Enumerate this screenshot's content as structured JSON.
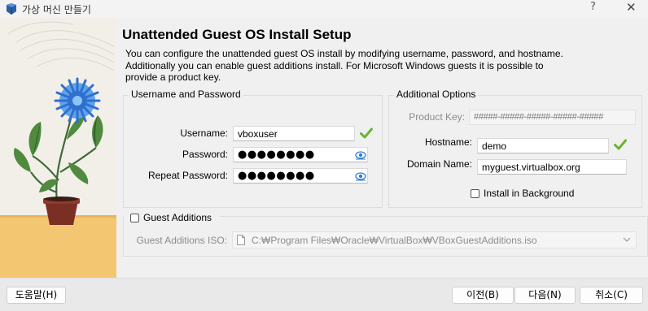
{
  "window": {
    "title": "가상 머신 만들기",
    "help_glyph": "?",
    "close_glyph": "✕"
  },
  "page": {
    "heading": "Unattended Guest OS Install Setup",
    "description": "You can configure the unattended guest OS install by modifying username, password, and hostname. Additionally you can enable guest additions install. For Microsoft Windows guests it is possible to provide a product key."
  },
  "user_group": {
    "title": "Username and Password",
    "username_label": "Username:",
    "username_value": "vboxuser",
    "password_label": "Password:",
    "password_value": "●●●●●●●●",
    "repeat_label": "Repeat Password:",
    "repeat_value": "●●●●●●●●"
  },
  "options_group": {
    "title": "Additional Options",
    "product_key_label": "Product Key:",
    "product_key_value": "#####-#####-#####-#####-#####",
    "hostname_label": "Hostname:",
    "hostname_value": "demo",
    "domain_label": "Domain Name:",
    "domain_value": "myguest.virtualbox.org",
    "install_bg_label": "Install in Background",
    "install_bg_checked": false
  },
  "guest_additions": {
    "checkbox_label": "Guest Additions",
    "checked": false,
    "iso_label": "Guest Additions ISO:",
    "iso_path": "C:₩Program Files₩Oracle₩VirtualBox₩VBoxGuestAdditions.iso"
  },
  "buttons": {
    "help": "도움말(H)",
    "back": "이전(B)",
    "next": "다음(N)",
    "cancel": "취소(C)"
  },
  "icons": {
    "app": "virtualbox-icon",
    "valid": "green-check-icon",
    "reveal": "eye-icon",
    "file": "file-icon",
    "dropdown": "chevron-down-icon"
  },
  "colors": {
    "valid_check": "#6ab42d",
    "eye_blue": "#2e7cd6",
    "flower_blue": "#2f6fcf",
    "pot": "#7a2e24",
    "table": "#f3c771"
  }
}
